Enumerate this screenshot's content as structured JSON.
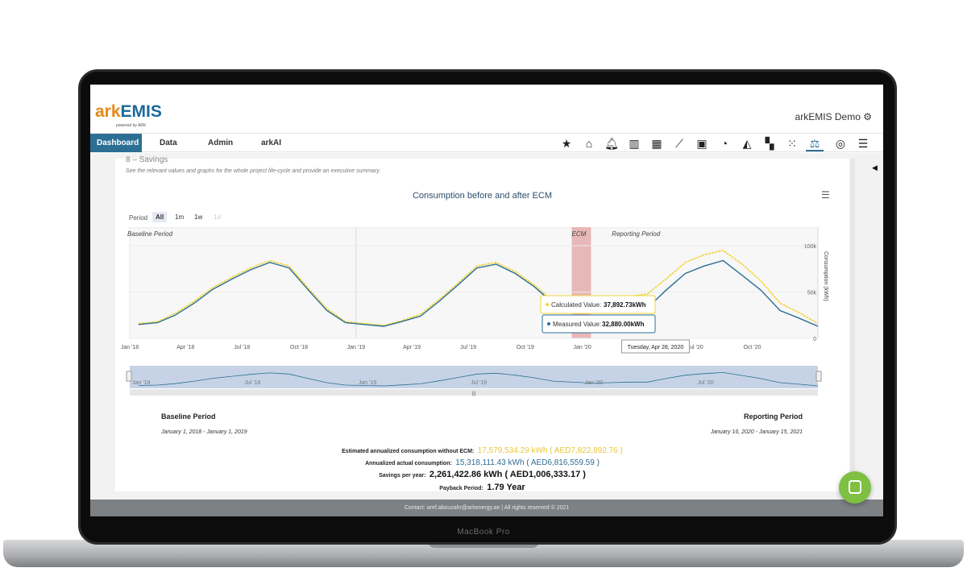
{
  "device": {
    "label": "MacBook Pro"
  },
  "app": {
    "brand_part1": "ark",
    "brand_part2": "EMIS",
    "powered_by": "powered by ARK"
  },
  "user_menu": {
    "label": "arkEMIS Demo ⚙"
  },
  "nav": {
    "tabs": [
      {
        "label": "Dashboard",
        "active": true
      },
      {
        "label": "Data"
      },
      {
        "label": "Admin"
      },
      {
        "label": "arkAI"
      }
    ]
  },
  "toolbar_icons": [
    "star-icon",
    "home-icon",
    "bell-icon",
    "bar-chart-icon",
    "calculator-icon",
    "line-chart-icon",
    "money-icon",
    "gauge-icon",
    "area-chart-icon",
    "grid-icon",
    "dots-grid-icon",
    "scale-icon",
    "target-icon",
    "database-icon"
  ],
  "section": {
    "title": "8 – Savings",
    "subtitle": "See the relevant values and graphs for the whole project life-cycle and provide an executive summary."
  },
  "chart_data": {
    "type": "line",
    "title": "Consumption before and after ECM",
    "period_label": "Period",
    "range_buttons": [
      "All",
      "1m",
      "1w",
      "1d"
    ],
    "ylabel": "Consumption (kWh)",
    "ylim": [
      0,
      120000
    ],
    "y_ticks": [
      "0",
      "50k",
      "100k"
    ],
    "x_ticks": [
      "Jan '18",
      "Apr '18",
      "Jul '18",
      "Oct '18",
      "Jan '19",
      "Apr '19",
      "Jul '19",
      "Oct '19",
      "Jan '20",
      "Apr '20",
      "Jul '20",
      "Oct '20"
    ],
    "navigator_ticks": [
      "Jan '18",
      "Jul '18",
      "Jan '19",
      "Jul '19",
      "Jan '20",
      "Jul '20"
    ],
    "bands": [
      {
        "label": "Baseline Period",
        "start": "2018-01-01",
        "end": "2019-01-01"
      },
      {
        "label": "ECM",
        "start": "2019-12-15",
        "end": "2020-01-15"
      },
      {
        "label": "Reporting Period",
        "start": "2020-01-16",
        "end": "2021-01-15"
      }
    ],
    "series": [
      {
        "name": "Calculated Value",
        "color": "#f2d43a",
        "x": [
          "2018-01",
          "2018-02",
          "2018-03",
          "2018-04",
          "2018-05",
          "2018-06",
          "2018-07",
          "2018-08",
          "2018-09",
          "2018-10",
          "2018-11",
          "2018-12",
          "2019-01",
          "2019-02",
          "2019-03",
          "2019-04",
          "2019-05",
          "2019-06",
          "2019-07",
          "2019-08",
          "2019-09",
          "2019-10",
          "2019-11",
          "2020-01",
          "2020-02",
          "2020-03",
          "2020-04",
          "2020-05",
          "2020-06",
          "2020-07",
          "2020-08",
          "2020-09",
          "2020-10",
          "2020-11",
          "2020-12",
          "2021-01"
        ],
        "values": [
          16000,
          18000,
          27000,
          40000,
          55000,
          66000,
          76000,
          84000,
          78000,
          55000,
          32000,
          18000,
          16000,
          14000,
          19000,
          26000,
          42000,
          60000,
          78000,
          82000,
          72000,
          58000,
          40000,
          34000,
          38000,
          45000,
          48000,
          64000,
          82000,
          90000,
          95000,
          80000,
          62000,
          38000,
          28000,
          16000
        ]
      },
      {
        "name": "Measured Value",
        "color": "#2a6f94",
        "x": [
          "2018-01",
          "2018-02",
          "2018-03",
          "2018-04",
          "2018-05",
          "2018-06",
          "2018-07",
          "2018-08",
          "2018-09",
          "2018-10",
          "2018-11",
          "2018-12",
          "2019-01",
          "2019-02",
          "2019-03",
          "2019-04",
          "2019-05",
          "2019-06",
          "2019-07",
          "2019-08",
          "2019-09",
          "2019-10",
          "2019-11",
          "2020-01",
          "2020-02",
          "2020-03",
          "2020-04",
          "2020-05",
          "2020-06",
          "2020-07",
          "2020-08",
          "2020-09",
          "2020-10",
          "2020-11",
          "2020-12",
          "2021-01"
        ],
        "values": [
          15000,
          17000,
          25000,
          38000,
          53000,
          64000,
          74000,
          82000,
          76000,
          53000,
          30000,
          17000,
          15000,
          13000,
          18000,
          24000,
          40000,
          58000,
          76000,
          80000,
          70000,
          56000,
          38000,
          28000,
          30000,
          33000,
          32880,
          52000,
          70000,
          78000,
          84000,
          68000,
          52000,
          30000,
          22000,
          13000
        ]
      }
    ],
    "tooltip": {
      "calc_label": "Calculated Value:",
      "calc_value": "37,892.73kWh",
      "meas_label": "Measured Value:",
      "meas_value": "32,880.00kWh",
      "date": "Tuesday, Apr 28, 2020"
    }
  },
  "summary": {
    "baseline_label": "Baseline Period",
    "baseline_dates": "January 1, 2018 - January 1, 2019",
    "reporting_label": "Reporting Period",
    "reporting_dates": "January 16, 2020 - January 15, 2021",
    "without_ecm_label": "Estimated annualized consumption without ECM:",
    "without_ecm_value": "17,579,534.29 kWh ( AED7,822,892.76 )",
    "actual_label": "Annualized actual consumption:",
    "actual_value": "15,318,111.43 kWh ( AED6,816,559.59 )",
    "savings_label": "Savings per year:",
    "savings_value": "2,261,422.86 kWh ( AED1,006,333.17 )",
    "payback_label": "Payback Period:",
    "payback_value": "1.79 Year"
  },
  "footer": {
    "text": "Contact: aref.abouzahr@arkenergy.ae | All rights reserved © 2021"
  },
  "colors": {
    "accent": "#2d6f94",
    "calculated": "#f2d43a",
    "measured": "#2a6f94",
    "ecm_band": "#e8b7b7",
    "chat": "#7fc043"
  }
}
